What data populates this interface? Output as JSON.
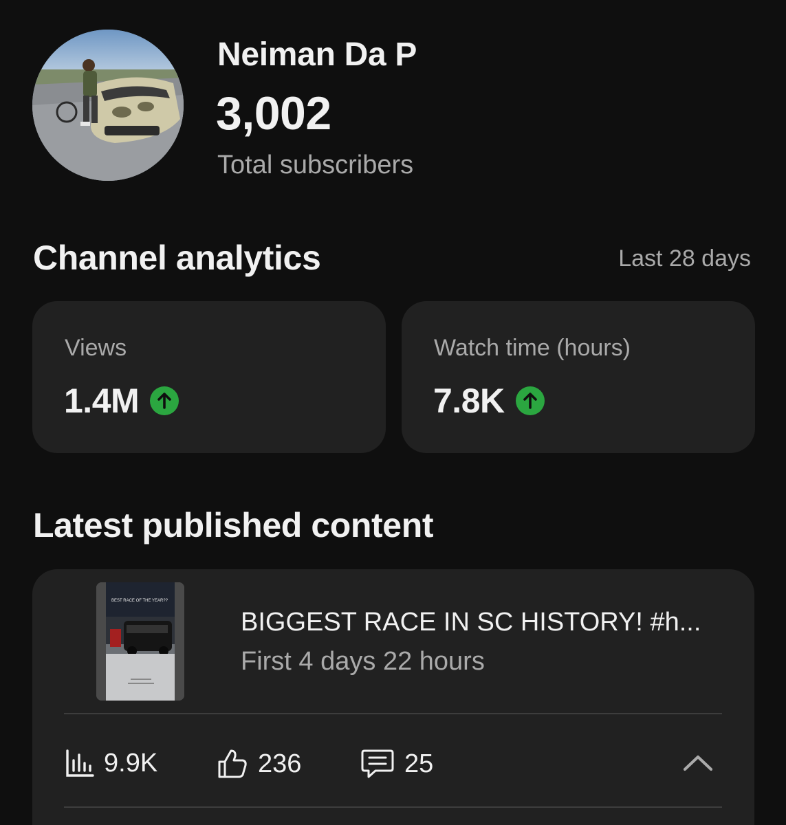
{
  "channel": {
    "name": "Neiman Da P",
    "subscriber_count": "3,002",
    "subscriber_label": "Total subscribers",
    "avatar_icon": "channel-avatar-photo"
  },
  "analytics": {
    "title": "Channel analytics",
    "period": "Last 28 days",
    "metrics": [
      {
        "label": "Views",
        "value": "1.4M",
        "trend": "up",
        "trend_color": "#2ba640"
      },
      {
        "label": "Watch time (hours)",
        "value": "7.8K",
        "trend": "up",
        "trend_color": "#2ba640"
      }
    ]
  },
  "latest": {
    "title": "Latest published content",
    "video": {
      "title": "BIGGEST RACE IN SC HISTORY! #h...",
      "subtitle": "First 4 days 22 hours",
      "thumbnail_caption": "BEST RACE OF THE YEAR??",
      "stats": {
        "views": "9.9K",
        "likes": "236",
        "comments": "25"
      },
      "icons": {
        "views": "bar-chart-icon",
        "likes": "thumbs-up-icon",
        "comments": "comment-icon",
        "toggle": "chevron-up-icon"
      }
    }
  },
  "colors": {
    "background": "#0f0f0f",
    "card": "#212121",
    "primary_text": "#f1f1f1",
    "secondary_text": "#aaaaaa",
    "trend_up": "#2ba640"
  }
}
